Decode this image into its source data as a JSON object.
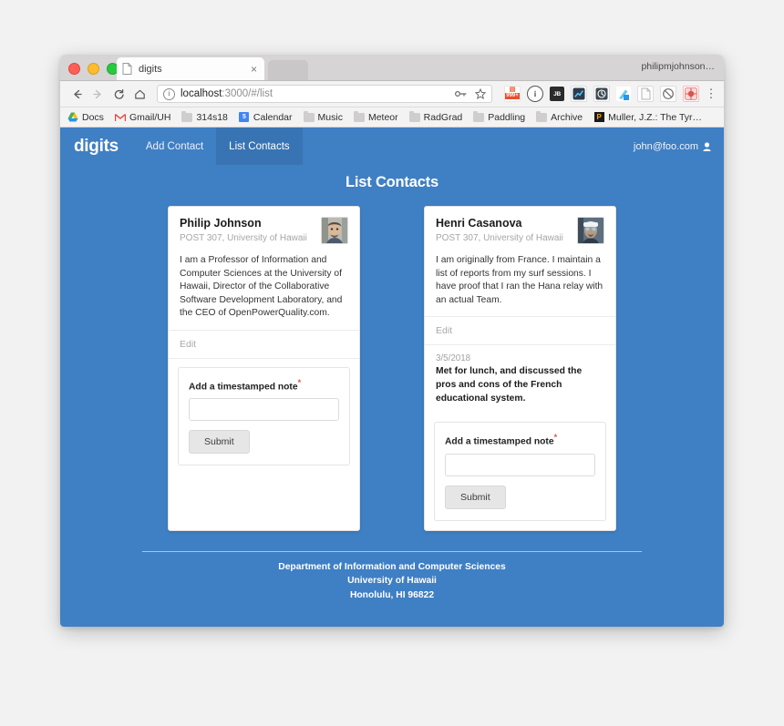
{
  "colors": {
    "brand_blue": "#3f7fc4",
    "nav_active_blue": "#3874b3",
    "required_red": "#d9534f"
  },
  "browser": {
    "tab": {
      "title": "digits",
      "close_label": "×"
    },
    "profile_name": "philipmjohnson…",
    "toolbar": {
      "back_label": "←",
      "forward_label": "→",
      "reload_label": "⟳",
      "home_label": "⌂",
      "url_host": "localhost",
      "url_rest": ":3000/#/list",
      "url_full": "localhost:3000/#/list",
      "menu_label": "⋮"
    },
    "extensions": [
      {
        "name": "feedly-icon",
        "top": "▤",
        "badge": "999+"
      },
      {
        "name": "info-icon",
        "glyph": "i"
      },
      {
        "name": "jetbrains-icon",
        "glyph": "JB"
      },
      {
        "name": "analytics-icon",
        "glyph": ""
      },
      {
        "name": "clock-icon",
        "glyph": ""
      },
      {
        "name": "pen-icon",
        "glyph": ""
      },
      {
        "name": "document-icon",
        "glyph": ""
      },
      {
        "name": "ghost-icon",
        "glyph": ""
      },
      {
        "name": "bug-icon",
        "glyph": ""
      }
    ],
    "bookmarks": [
      {
        "label": "Docs",
        "icon": "drive-icon"
      },
      {
        "label": "Gmail/UH",
        "icon": "gmail-icon"
      },
      {
        "label": "314s18",
        "icon": "folder-icon"
      },
      {
        "label": "Calendar",
        "icon": "calendar-icon",
        "glyph": "5"
      },
      {
        "label": "Music",
        "icon": "folder-icon"
      },
      {
        "label": "Meteor",
        "icon": "folder-icon"
      },
      {
        "label": "RadGrad",
        "icon": "folder-icon"
      },
      {
        "label": "Paddling",
        "icon": "folder-icon"
      },
      {
        "label": "Archive",
        "icon": "folder-icon"
      },
      {
        "label": "Muller, J.Z.: The Tyr…",
        "icon": "pocket-icon",
        "glyph": "P"
      }
    ]
  },
  "app": {
    "brand": "digits",
    "nav_links": [
      {
        "label": "Add Contact",
        "active": false
      },
      {
        "label": "List Contacts",
        "active": true
      }
    ],
    "account": {
      "email": "john@foo.com",
      "icon": "user-icon"
    },
    "page_title": "List Contacts",
    "cards": [
      {
        "name": "Philip Johnson",
        "meta": "POST 307, University of Hawaii",
        "avatar": "philip-johnson-avatar",
        "description": "I am a Professor of Information and Computer Sciences at the University of Hawaii, Director of the Collaborative Software Development Laboratory, and the CEO of OpenPowerQuality.com.",
        "edit_label": "Edit",
        "notes": [],
        "form": {
          "label": "Add a timestamped note",
          "required_marker": "*",
          "input_value": "",
          "submit_label": "Submit"
        }
      },
      {
        "name": "Henri Casanova",
        "meta": "POST 307, University of Hawaii",
        "avatar": "henri-casanova-avatar",
        "description": "I am originally from France. I maintain a list of reports from my surf sessions. I have proof that I ran the Hana relay with an actual Team.",
        "edit_label": "Edit",
        "notes": [
          {
            "date": "3/5/2018",
            "text": "Met for lunch, and discussed the pros and cons of the French educational system."
          }
        ],
        "form": {
          "label": "Add a timestamped note",
          "required_marker": "*",
          "input_value": "",
          "submit_label": "Submit"
        }
      }
    ],
    "footer": {
      "line1": "Department of Information and Computer Sciences",
      "line2": "University of Hawaii",
      "line3": "Honolulu, HI 96822"
    }
  }
}
